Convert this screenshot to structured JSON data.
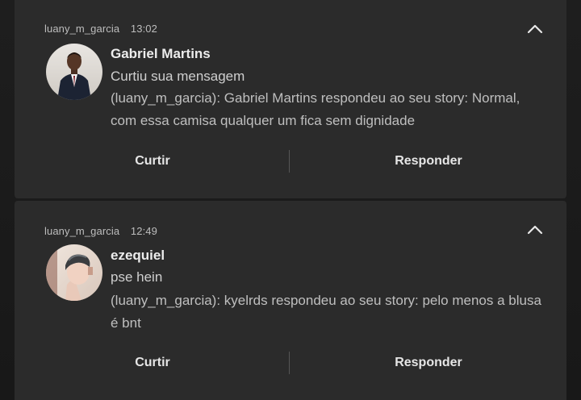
{
  "notifications": [
    {
      "sender": "luany_m_garcia",
      "time": "13:02",
      "title": "Gabriel Martins",
      "subtitle": "Curtiu sua mensagem",
      "body": "(luany_m_garcia): Gabriel Martins respondeu ao seu story: Normal, com essa camisa qualquer um fica sem dignidade",
      "like_label": "Curtir",
      "reply_label": "Responder",
      "collapse_icon": "chevron-up-icon",
      "avatar_icon": "avatar-person-suit"
    },
    {
      "sender": "luany_m_garcia",
      "time": "12:49",
      "title": "ezequiel",
      "subtitle": "pse hein",
      "body": "(luany_m_garcia): kyelrds respondeu ao seu story: pelo menos a blusa é bnt",
      "like_label": "Curtir",
      "reply_label": "Responder",
      "collapse_icon": "chevron-up-icon",
      "avatar_icon": "avatar-person-profile"
    }
  ],
  "colors": {
    "background": "#1b1b1b",
    "card": "#2b2b2b",
    "text_primary": "#ececec",
    "text_secondary": "#bfbfbf",
    "divider": "#555555"
  }
}
